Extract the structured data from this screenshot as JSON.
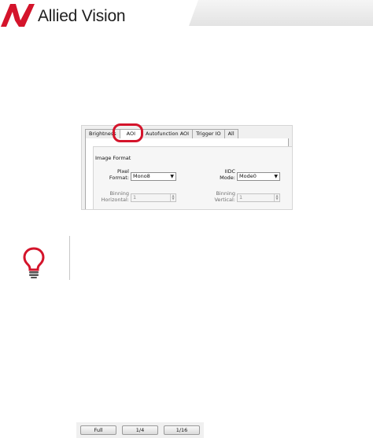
{
  "header": {
    "brand": "Allied Vision",
    "logo_icon": "allied-vision-logo",
    "accent": "#d4142b"
  },
  "panel": {
    "tabs": [
      {
        "label": "Brightness",
        "active": false
      },
      {
        "label": "AOI",
        "active": true
      },
      {
        "label": "Autofunction AOI",
        "active": false
      },
      {
        "label": "Trigger IO",
        "active": false
      },
      {
        "label": "All",
        "active": false
      }
    ],
    "group_title": "Image Format",
    "pixel_format": {
      "label_1": "Pixel",
      "label_2": "Format:",
      "value": "Mono8"
    },
    "iidc_mode": {
      "label_1": "IIDC",
      "label_2": "Mode:",
      "value": "Mode0"
    },
    "binning_horizontal": {
      "label_1": "Binning",
      "label_2": "Horizontal:",
      "value": "1"
    },
    "binning_vertical": {
      "label_1": "Binning",
      "label_2": "Vertical:",
      "value": "1"
    }
  },
  "tip": {
    "icon": "lightbulb-icon"
  },
  "buttons": {
    "full": "Full",
    "quarter": "1/4",
    "sixteenth": "1/16"
  }
}
